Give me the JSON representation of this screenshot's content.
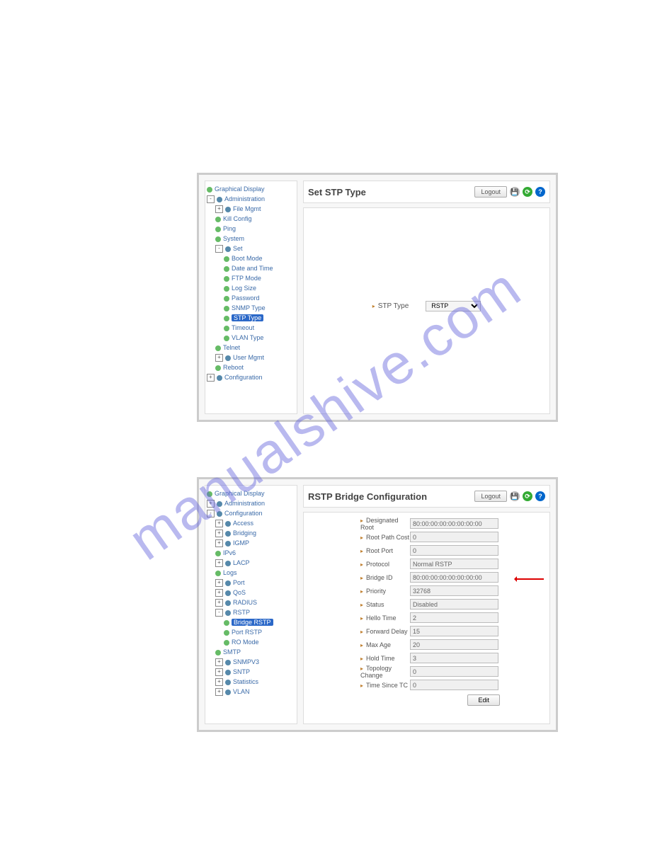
{
  "watermark": "manualshive.com",
  "panel1": {
    "title": "Set STP Type",
    "logout": "Logout",
    "tree": {
      "graphical_display": "Graphical Display",
      "administration": "Administration",
      "file_mgmt": "File Mgmt",
      "kill_config": "Kill Config",
      "ping": "Ping",
      "system": "System",
      "set": "Set",
      "boot_mode": "Boot Mode",
      "date_time": "Date and Time",
      "ftp_mode": "FTP Mode",
      "log_size": "Log Size",
      "password": "Password",
      "snmp_type": "SNMP Type",
      "stp_type": "STP Type",
      "timeout": "Timeout",
      "vlan_type": "VLAN Type",
      "telnet": "Telnet",
      "user_mgmt": "User Mgmt",
      "reboot": "Reboot",
      "configuration": "Configuration"
    },
    "field_label": "STP Type",
    "select_value": "RSTP"
  },
  "panel2": {
    "title": "RSTP Bridge Configuration",
    "logout": "Logout",
    "edit": "Edit",
    "tree": {
      "graphical_display": "Graphical Display",
      "administration": "Administration",
      "configuration": "Configuration",
      "access": "Access",
      "bridging": "Bridging",
      "igmp": "IGMP",
      "ipv6": "IPv6",
      "lacp": "LACP",
      "logs": "Logs",
      "port": "Port",
      "qos": "QoS",
      "radius": "RADIUS",
      "rstp": "RSTP",
      "bridge_rstp": "Bridge RSTP",
      "port_rstp": "Port RSTP",
      "ro_mode": "RO Mode",
      "smtp": "SMTP",
      "snmpv3": "SNMPV3",
      "sntp": "SNTP",
      "statistics": "Statistics",
      "vlan": "VLAN"
    },
    "rows": [
      {
        "label": "Designated Root",
        "value": "80:00:00:00:00:00:00:00"
      },
      {
        "label": "Root Path Cost",
        "value": "0"
      },
      {
        "label": "Root Port",
        "value": "0"
      },
      {
        "label": "Protocol",
        "value": "Normal RSTP"
      },
      {
        "label": "Bridge ID",
        "value": "80:00:00:00:00:00:00:00"
      },
      {
        "label": "Priority",
        "value": "32768"
      },
      {
        "label": "Status",
        "value": "Disabled"
      },
      {
        "label": "Hello Time",
        "value": "2"
      },
      {
        "label": "Forward Delay",
        "value": "15"
      },
      {
        "label": "Max Age",
        "value": "20"
      },
      {
        "label": "Hold Time",
        "value": "3"
      },
      {
        "label": "Topology Change",
        "value": "0"
      },
      {
        "label": "Time Since TC",
        "value": "0"
      }
    ]
  }
}
